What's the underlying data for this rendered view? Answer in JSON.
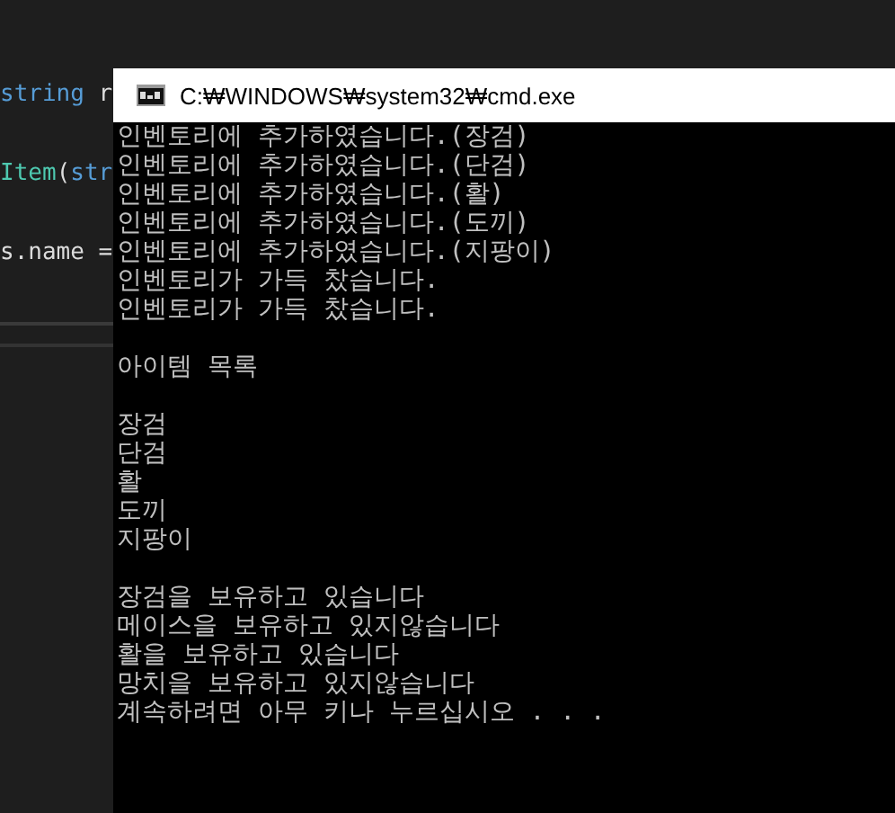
{
  "editor": {
    "lines": [
      {
        "segments": [
          {
            "text": "string",
            "kind": "keyword"
          },
          {
            "text": " r",
            "kind": "plain"
          }
        ]
      },
      {
        "segments": [
          {
            "text": "Item",
            "kind": "type"
          },
          {
            "text": "(",
            "kind": "plain"
          },
          {
            "text": "str",
            "kind": "keyword"
          }
        ]
      },
      {
        "segments": [
          {
            "text": "s.name =",
            "kind": "plain"
          }
        ]
      }
    ]
  },
  "window": {
    "title": "C:₩WINDOWS₩system32₩cmd.exe"
  },
  "console": {
    "blocks": [
      [
        "인벤토리에 추가하였습니다.(장검)",
        "인벤토리에 추가하였습니다.(단검)",
        "인벤토리에 추가하였습니다.(활)",
        "인벤토리에 추가하였습니다.(도끼)",
        "인벤토리에 추가하였습니다.(지팡이)",
        "인벤토리가 가득 찼습니다.",
        "인벤토리가 가득 찼습니다."
      ],
      [
        "아이템 목록"
      ],
      [
        "장검",
        "단검",
        "활",
        "도끼",
        "지팡이"
      ],
      [
        "장검을 보유하고 있습니다",
        "메이스을 보유하고 있지않습니다",
        "활을 보유하고 있습니다",
        "망치을 보유하고 있지않습니다",
        "계속하려면 아무 키나 누르십시오 . . ."
      ]
    ]
  }
}
